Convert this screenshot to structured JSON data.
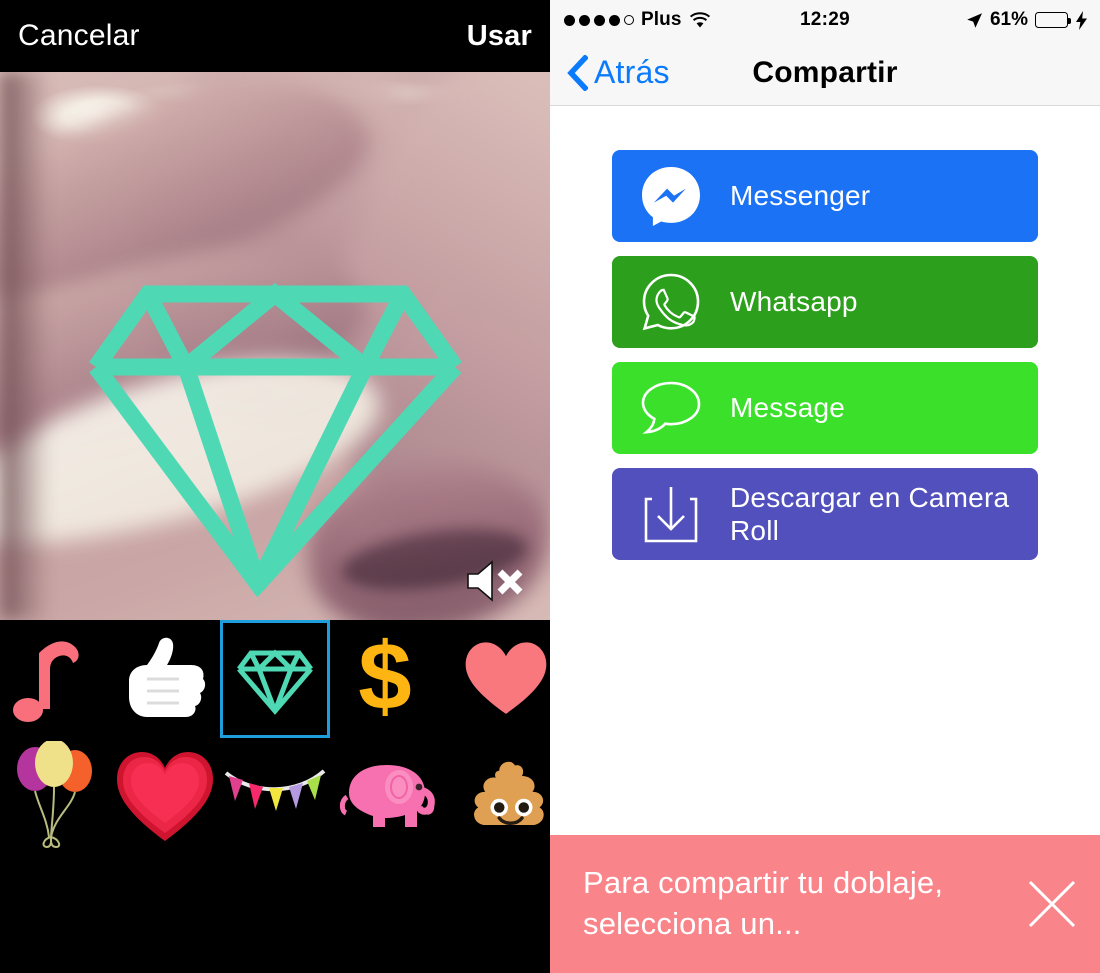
{
  "editor": {
    "cancel_label": "Cancelar",
    "use_label": "Usar",
    "mute_icon": "speaker-mute-icon",
    "overlay_sticker": "diamond",
    "overlay_color": "#4ed9b4",
    "selection_color": "#1e9fdc",
    "stickers": [
      {
        "id": "music-note",
        "name": "music-note-sticker",
        "selected": false
      },
      {
        "id": "thumbs-up",
        "name": "thumbs-up-sticker",
        "selected": false
      },
      {
        "id": "diamond",
        "name": "diamond-sticker",
        "selected": true
      },
      {
        "id": "dollar-sign",
        "name": "dollar-sign-sticker",
        "selected": false
      },
      {
        "id": "heart-pink",
        "name": "pink-heart-sticker",
        "selected": false
      },
      {
        "id": "balloons",
        "name": "balloons-sticker",
        "selected": false
      },
      {
        "id": "heart-red",
        "name": "red-heart-sticker",
        "selected": false
      },
      {
        "id": "bunting",
        "name": "party-bunting-sticker",
        "selected": false
      },
      {
        "id": "elephant",
        "name": "pink-elephant-sticker",
        "selected": false
      },
      {
        "id": "poop",
        "name": "poop-sticker",
        "selected": false
      }
    ]
  },
  "status_bar": {
    "signal_filled": 4,
    "signal_empty": 1,
    "carrier": "Plus",
    "wifi_icon": "wifi-icon",
    "time": "12:29",
    "location_icon": "location-arrow-icon",
    "battery_percent": "61%",
    "battery_level": 61,
    "battery_color": "#4cd964",
    "charging_icon": "lightning-bolt-icon"
  },
  "nav": {
    "back_icon": "chevron-left-icon",
    "back_label": "Atrás",
    "title": "Compartir",
    "tint_color": "#0b7bfb"
  },
  "share": {
    "buttons": [
      {
        "label": "Messenger",
        "icon": "messenger-icon",
        "color": "#1b72f5",
        "name": "share-messenger-button"
      },
      {
        "label": "Whatsapp",
        "icon": "whatsapp-icon",
        "color": "#2ca01c",
        "name": "share-whatsapp-button"
      },
      {
        "label": "Message",
        "icon": "message-bubble-icon",
        "color": "#3ae02a",
        "name": "share-message-button"
      },
      {
        "label": "Descargar en Camera Roll",
        "icon": "download-icon",
        "color": "#5250bc",
        "name": "share-download-button"
      }
    ]
  },
  "toast": {
    "text": "Para compartir tu doblaje, selecciona un...",
    "color": "#f9848a",
    "close_icon": "close-x-icon"
  }
}
